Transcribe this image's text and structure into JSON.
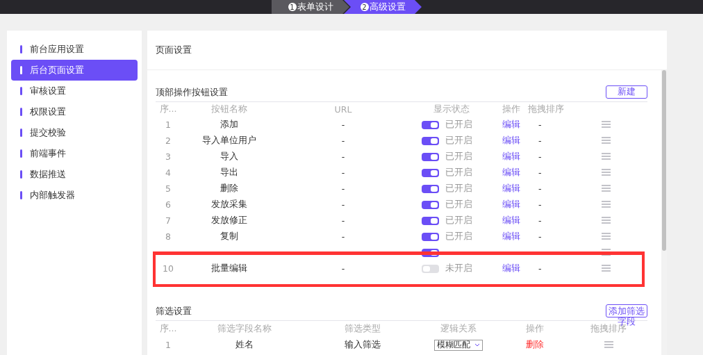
{
  "steps": [
    {
      "number": "1",
      "label": "表单设计",
      "selected": false
    },
    {
      "number": "2",
      "label": "高级设置",
      "selected": true
    }
  ],
  "sidebar": {
    "items": [
      {
        "label": "前台应用设置",
        "selected": false
      },
      {
        "label": "后台页面设置",
        "selected": true
      },
      {
        "label": "审核设置",
        "selected": false
      },
      {
        "label": "权限设置",
        "selected": false
      },
      {
        "label": "提交校验",
        "selected": false
      },
      {
        "label": "前端事件",
        "selected": false
      },
      {
        "label": "数据推送",
        "selected": false
      },
      {
        "label": "内部触发器",
        "selected": false
      }
    ]
  },
  "page_title": "页面设置",
  "top_buttons": {
    "title": "顶部操作按钮设置",
    "add_button": "新建",
    "columns": [
      "序...",
      "按钮名称",
      "URL",
      "显示状态",
      "操作",
      "拖拽排序"
    ],
    "rows": [
      {
        "index": "1",
        "name": "添加",
        "url": "-",
        "on": true,
        "status": "已开启",
        "action": "编辑",
        "extra": "-"
      },
      {
        "index": "2",
        "name": "导入单位用户",
        "url": "-",
        "on": true,
        "status": "已开启",
        "action": "编辑",
        "extra": "-"
      },
      {
        "index": "3",
        "name": "导入",
        "url": "-",
        "on": true,
        "status": "已开启",
        "action": "编辑",
        "extra": "-"
      },
      {
        "index": "4",
        "name": "导出",
        "url": "-",
        "on": true,
        "status": "已开启",
        "action": "编辑",
        "extra": "-"
      },
      {
        "index": "5",
        "name": "删除",
        "url": "-",
        "on": true,
        "status": "已开启",
        "action": "编辑",
        "extra": "-"
      },
      {
        "index": "6",
        "name": "发放采集",
        "url": "-",
        "on": true,
        "status": "已开启",
        "action": "编辑",
        "extra": "-"
      },
      {
        "index": "7",
        "name": "发放修正",
        "url": "-",
        "on": true,
        "status": "已开启",
        "action": "编辑",
        "extra": "-"
      },
      {
        "index": "8",
        "name": "复制",
        "url": "-",
        "on": true,
        "status": "已开启",
        "action": "编辑",
        "extra": "-"
      },
      {
        "on": true
      },
      {
        "index": "10",
        "name": "批量编辑",
        "url": "-",
        "on": false,
        "status": "未开启",
        "action": "编辑",
        "extra": "-"
      }
    ]
  },
  "filter": {
    "title": "筛选设置",
    "add_button": "添加筛选字段",
    "columns": [
      "序...",
      "筛选字段名称",
      "筛选类型",
      "逻辑关系",
      "操作",
      "拖拽排序"
    ],
    "rows": [
      {
        "index": "1",
        "name": "姓名",
        "type": "输入筛选",
        "logic": "模糊匹配",
        "action": "删除"
      }
    ]
  }
}
